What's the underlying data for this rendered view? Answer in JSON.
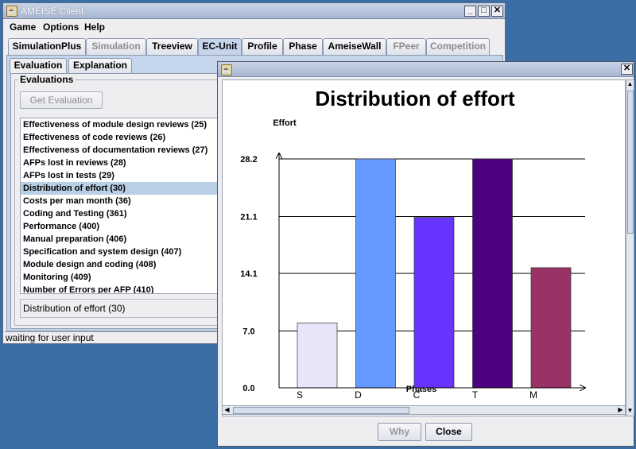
{
  "main_window": {
    "title": "AMEISE Client",
    "menu": [
      "Game",
      "Options",
      "Help"
    ],
    "tabs": [
      {
        "label": "SimulationPlus",
        "enabled": true
      },
      {
        "label": "Simulation",
        "enabled": false
      },
      {
        "label": "Treeview",
        "enabled": true
      },
      {
        "label": "EC-Unit",
        "enabled": true,
        "selected": true
      },
      {
        "label": "Profile",
        "enabled": true
      },
      {
        "label": "Phase",
        "enabled": true
      },
      {
        "label": "AmeiseWall",
        "enabled": true
      },
      {
        "label": "FPeer",
        "enabled": false
      },
      {
        "label": "Competition",
        "enabled": false
      }
    ],
    "subtabs": [
      "Evaluation",
      "Explanation"
    ],
    "group_label": "Evaluations",
    "get_button": "Get Evaluation",
    "evaluations": [
      "Effectiveness of module design reviews (25)",
      "Effectiveness of code reviews (26)",
      "Effectiveness of documentation reviews (27)",
      "AFPs lost in reviews (28)",
      "AFPs lost in tests (29)",
      "Distribution of effort (30)",
      "Costs per man month (36)",
      "Coding and Testing (361)",
      "Performance (400)",
      "Manual preparation (406)",
      "Specification and system design (407)",
      "Module design and coding (408)",
      "Monitoring (409)",
      "Number of Errors per AFP (410)"
    ],
    "selected_index": 5,
    "selected_field": "Distribution of effort (30)",
    "status": "waiting for user input"
  },
  "dialog": {
    "buttons": {
      "why": "Why",
      "close": "Close"
    }
  },
  "chart_data": {
    "type": "bar",
    "title": "Distribution of effort",
    "ylabel": "Effort",
    "xlabel": "Phases",
    "categories": [
      "S",
      "D",
      "C",
      "T",
      "M"
    ],
    "values": [
      8.0,
      28.2,
      21.0,
      28.2,
      14.8
    ],
    "colors": [
      "#e6e6f8",
      "#6699ff",
      "#6633ff",
      "#4d0080",
      "#993366"
    ],
    "yticks": [
      "0.0",
      "7.0",
      "14.1",
      "21.1",
      "28.2"
    ],
    "ylim": [
      0,
      28.2
    ],
    "grid": true
  }
}
